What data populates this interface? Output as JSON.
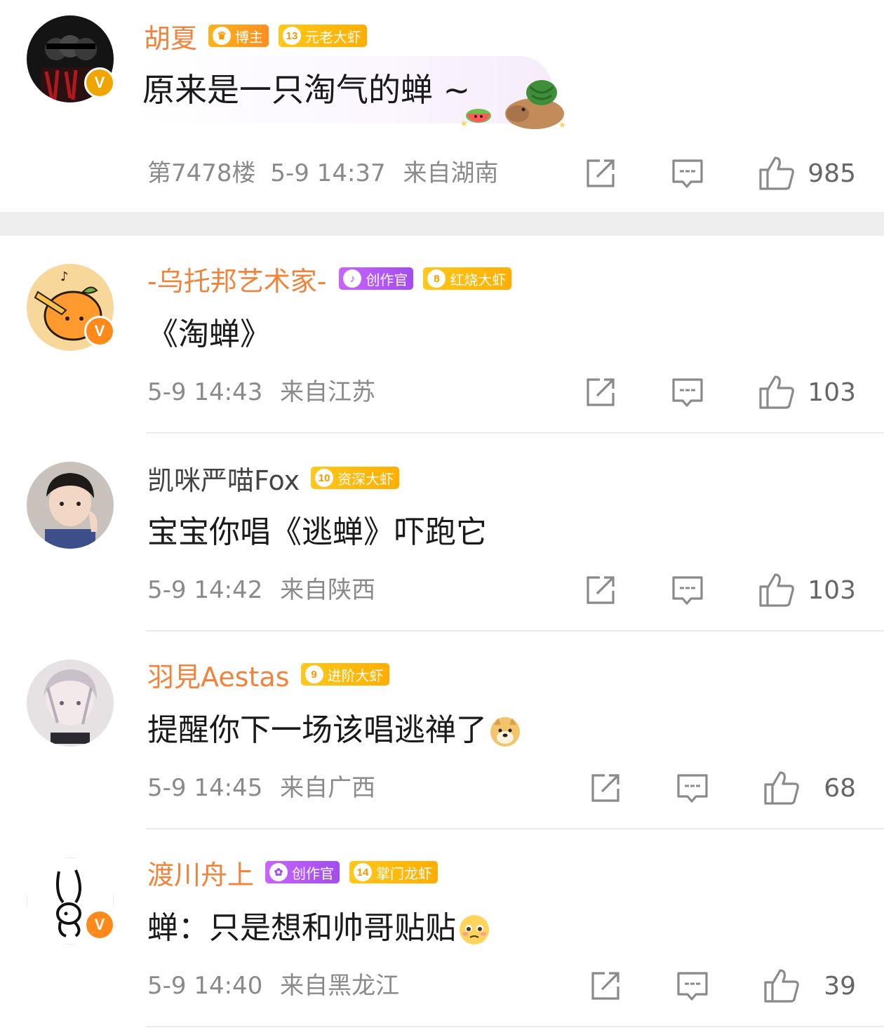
{
  "comments": [
    {
      "username": "胡夏",
      "badges": [
        {
          "type": "blogger",
          "emblem": "♛",
          "label": "博主"
        },
        {
          "type": "level",
          "emblem": "13",
          "label": "元老大虾"
        }
      ],
      "text": "原来是一只淘气的蝉 ~",
      "floor": "第7478楼",
      "time": "5-9 14:37",
      "location": "来自湖南",
      "likes": "985"
    },
    {
      "username": "-乌托邦艺术家-",
      "badges": [
        {
          "type": "creator",
          "emblem": "♪",
          "label": "创作官"
        },
        {
          "type": "level",
          "emblem": "8",
          "label": "红烧大虾"
        }
      ],
      "text": "《淘蝉》",
      "time": "5-9 14:43",
      "location": "来自江苏",
      "likes": "103"
    },
    {
      "username": "凯咪严喵Fox",
      "badges": [
        {
          "type": "level",
          "emblem": "10",
          "label": "资深大虾"
        }
      ],
      "text": "宝宝你唱《逃蝉》吓跑它",
      "time": "5-9 14:42",
      "location": "来自陕西",
      "likes": "103"
    },
    {
      "username": "羽見Aestas",
      "badges": [
        {
          "type": "level",
          "emblem": "9",
          "label": "进阶大虾"
        }
      ],
      "text": "提醒你下一场该唱逃禅了",
      "time": "5-9 14:45",
      "location": "来自广西",
      "likes": "68"
    },
    {
      "username": "渡川舟上",
      "badges": [
        {
          "type": "creator",
          "emblem": "✿",
          "label": "创作官"
        },
        {
          "type": "level",
          "emblem": "14",
          "label": "掌门龙虾"
        }
      ],
      "text": "蝉：只是想和帅哥贴贴",
      "time": "5-9 14:40",
      "location": "来自黑龙江",
      "likes": "39"
    }
  ],
  "verified_mark": "V",
  "icons": {
    "forward": "share-icon",
    "reply": "comment-icon",
    "like": "thumbs-up-icon"
  },
  "colors": {
    "vip_name": "#f0843c",
    "level_badge": "#ffb400",
    "creator_badge": "#b057f5",
    "meta_text": "#8a8a8a"
  }
}
